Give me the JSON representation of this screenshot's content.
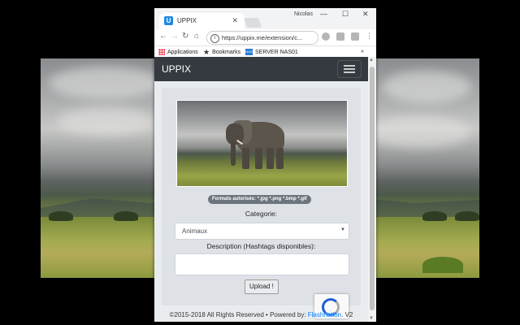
{
  "browser": {
    "tab_title": "UPPIX",
    "tab_favicon": "U",
    "user_label": "Nicolas",
    "url": "https://uppix.me/extension/c...",
    "bookmarks": [
      {
        "label": "Applications",
        "icon": "apps-grid-icon"
      },
      {
        "label": "Bookmarks",
        "icon": "star-icon"
      },
      {
        "label": "SERVER NAS01",
        "icon": "nas-icon"
      }
    ],
    "more_label": "»"
  },
  "app": {
    "brand": "UPPIX",
    "formats_badge": "Formats autorisés: *.jpg *.png *.bmp *.gif",
    "category_label": "Categorie:",
    "category_value": "Animaux",
    "description_label": "Description (Hashtags disponibles):",
    "description_value": "",
    "upload_button": "Upload !",
    "footer_text": "©2015-2018 All Rights Reserved • Powered by: ",
    "footer_link": "Flashnation",
    "footer_suffix": ". V2"
  },
  "colors": {
    "navbar": "#343a40",
    "link": "#007bff",
    "badge": "#6c757d"
  }
}
